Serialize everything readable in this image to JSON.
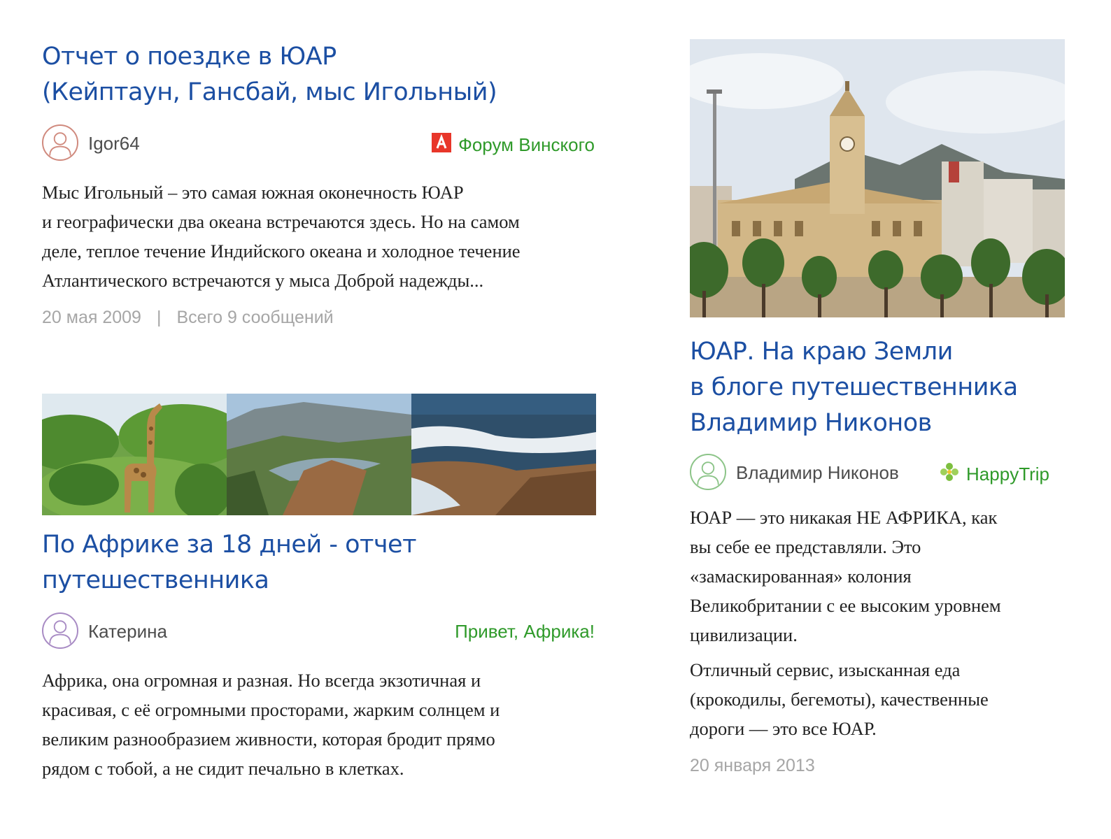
{
  "cards": [
    {
      "title_lines": [
        "Отчет о поездке в ЮАР",
        "(Кейптаун, Гансбай, мыс Игольный)"
      ],
      "author": "Igor64",
      "source": "Форум Винского",
      "source_icon": "forum-a-icon",
      "excerpt_lines": [
        "Мыс Игольный – это самая южная оконечность ЮАР",
        "и географически два океана встречаются здесь. Но на самом",
        "деле, теплое течение Индийского океана и холодное течение",
        "Атлантического встречаются у мыса Доброй надежды..."
      ],
      "date": "20 мая 2009",
      "separator": "|",
      "messages": "Всего 9 сообщений"
    },
    {
      "title_lines": [
        "По Африке за 18 дней - отчет",
        "путешественника"
      ],
      "author": "Катерина",
      "source": "Привет, Африка!",
      "excerpt_lines": [
        "Африка, она огромная и разная. Но всегда экзотичная и",
        "красивая, с её огромными просторами, жарким солнцем и",
        "великим разнообразием живности, которая бродит прямо",
        "рядом с тобой, а не сидит печально в клетках."
      ]
    },
    {
      "title_lines": [
        "ЮАР. На краю Земли",
        "в блоге путешественника",
        "Владимир Никонов"
      ],
      "author": "Владимир Никонов",
      "source": "HappyTrip",
      "source_icon": "happytrip-flower-icon",
      "paragraph1_lines": [
        "ЮАР — это никакая НЕ АФРИКА, как",
        "вы себе ее представляли. Это",
        "«замаскированная» колония",
        "Великобритании с ее высоким уровнем",
        "цивилизации."
      ],
      "paragraph2_lines": [
        "Отличный сервис, изысканная еда",
        "(крокодилы, бегемоты), качественные",
        "дороги — это все ЮАР."
      ],
      "date": "20 января 2013"
    }
  ],
  "colors": {
    "title": "#1c4fa3",
    "source_link": "#2f9a2a",
    "meta_gray": "#a6a6a6",
    "avatar_1": "#d08a7e",
    "avatar_2": "#a88bc4",
    "avatar_3": "#8cc488",
    "forum_icon": "#e8362a"
  }
}
